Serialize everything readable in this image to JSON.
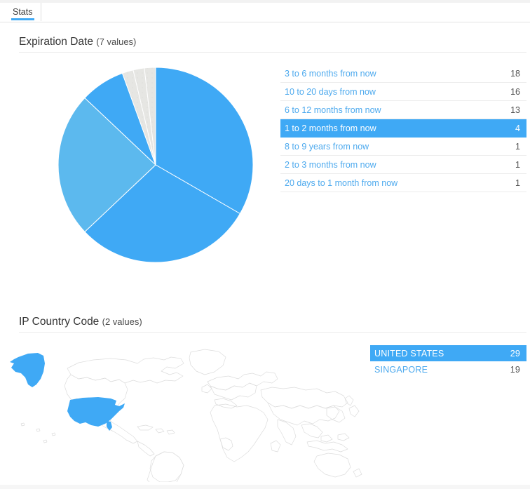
{
  "tabs": [
    {
      "label": "Stats",
      "active": true
    }
  ],
  "sections": [
    {
      "id": "expiration-date",
      "title": "Expiration Date",
      "subtitle": "(7 values)",
      "visual": "pie"
    },
    {
      "id": "ip-country-code",
      "title": "IP Country Code",
      "subtitle": "(2 values)",
      "visual": "map"
    }
  ],
  "colors": {
    "accent": "#3fa9f5",
    "link": "#4eaaee",
    "slice_1": "#3fa9f5",
    "slice_2": "#3fa9f5",
    "slice_3": "#5cb9ee",
    "slice_4": "#3fa9f5",
    "slice_small": "#e6e6e3",
    "map_highlight": "#3fa9f5",
    "map_outline": "#d8d8d8",
    "row_border": "#ececec"
  },
  "chart_data": [
    {
      "type": "pie",
      "title": "Expiration Date (7 values)",
      "legend": "right-list",
      "categories": [
        "3 to 6 months from now",
        "10 to 20 days from now",
        "6 to 12 months from now",
        "1 to 2 months from now",
        "8 to 9 years from now",
        "2 to 3 months from now",
        "20 days to 1 month from now"
      ],
      "values": [
        18,
        16,
        13,
        4,
        1,
        1,
        1
      ],
      "total": 54,
      "selected_index": 3,
      "slice_colors": [
        "#3fa9f5",
        "#3fa9f5",
        "#5cb9ee",
        "#3fa9f5",
        "#e6e6e3",
        "#e6e6e3",
        "#e6e6e3"
      ]
    },
    {
      "type": "map",
      "title": "IP Country Code (2 values)",
      "categories": [
        "UNITED STATES",
        "SINGAPORE"
      ],
      "values": [
        29,
        19
      ],
      "total": 48,
      "selected_index": 0,
      "highlighted_regions": [
        "UNITED STATES"
      ]
    }
  ],
  "expiration_list": {
    "rows": [
      {
        "label": "3 to 6 months from now",
        "count": "18",
        "selected": false
      },
      {
        "label": "10 to 20 days from now",
        "count": "16",
        "selected": false
      },
      {
        "label": "6 to 12 months from now",
        "count": "13",
        "selected": false
      },
      {
        "label": "1 to 2 months from now",
        "count": "4",
        "selected": true
      },
      {
        "label": "8 to 9 years from now",
        "count": "1",
        "selected": false
      },
      {
        "label": "2 to 3 months from now",
        "count": "1",
        "selected": false
      },
      {
        "label": "20 days to 1 month from now",
        "count": "1",
        "selected": false
      }
    ]
  },
  "country_list": {
    "rows": [
      {
        "label": "UNITED STATES",
        "count": "29",
        "selected": true
      },
      {
        "label": "SINGAPORE",
        "count": "19",
        "selected": false
      }
    ]
  }
}
